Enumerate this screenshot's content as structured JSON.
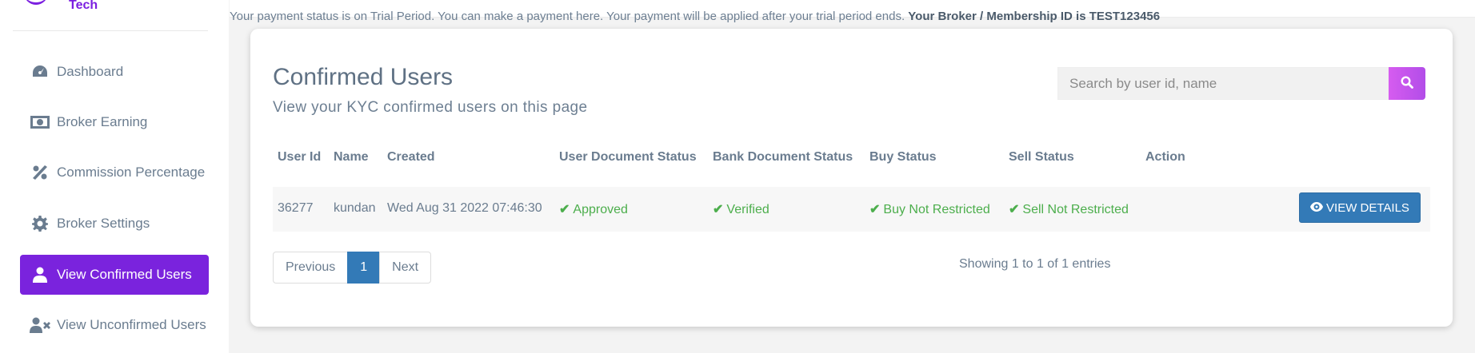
{
  "sidebar": {
    "brand": "Tech",
    "items": [
      {
        "label": "Dashboard",
        "icon": "dashboard-icon"
      },
      {
        "label": "Broker Earning",
        "icon": "money-icon"
      },
      {
        "label": "Commission Percentage",
        "icon": "percent-icon"
      },
      {
        "label": "Broker Settings",
        "icon": "gear-icon"
      },
      {
        "label": "View Confirmed Users",
        "icon": "user-icon",
        "active": true
      },
      {
        "label": "View Unconfirmed Users",
        "icon": "user-times-icon"
      }
    ]
  },
  "payment_bar": {
    "message": "Your payment status is on Trial Period. You can make a payment here. Your payment will be applied after your trial period ends.",
    "broker_id_text": "Your Broker / Membership ID is TEST123456"
  },
  "page": {
    "title": "Confirmed Users",
    "subtitle": "View your KYC confirmed users on this page"
  },
  "search": {
    "placeholder": "Search by user id, name",
    "value": ""
  },
  "table": {
    "headers": [
      "User Id",
      "Name",
      "Created",
      "User Document Status",
      "Bank Document Status",
      "Buy Status",
      "Sell Status",
      "Action"
    ],
    "rows": [
      {
        "user_id": "36277",
        "name": "kundan",
        "created": "Wed Aug 31 2022 07:46:30",
        "user_doc_status": "Approved",
        "bank_doc_status": "Verified",
        "buy_status": "Buy Not Restricted",
        "sell_status": "Sell Not Restricted",
        "action_label": "VIEW DETAILS"
      }
    ]
  },
  "pagination": {
    "previous": "Previous",
    "current": "1",
    "next": "Next",
    "info": "Showing 1 to 1 of 1 entries"
  },
  "colors": {
    "accent": "#7a23dd",
    "primary_button": "#337ab7",
    "success": "#4cae4c",
    "search_button": "#c856ec"
  }
}
